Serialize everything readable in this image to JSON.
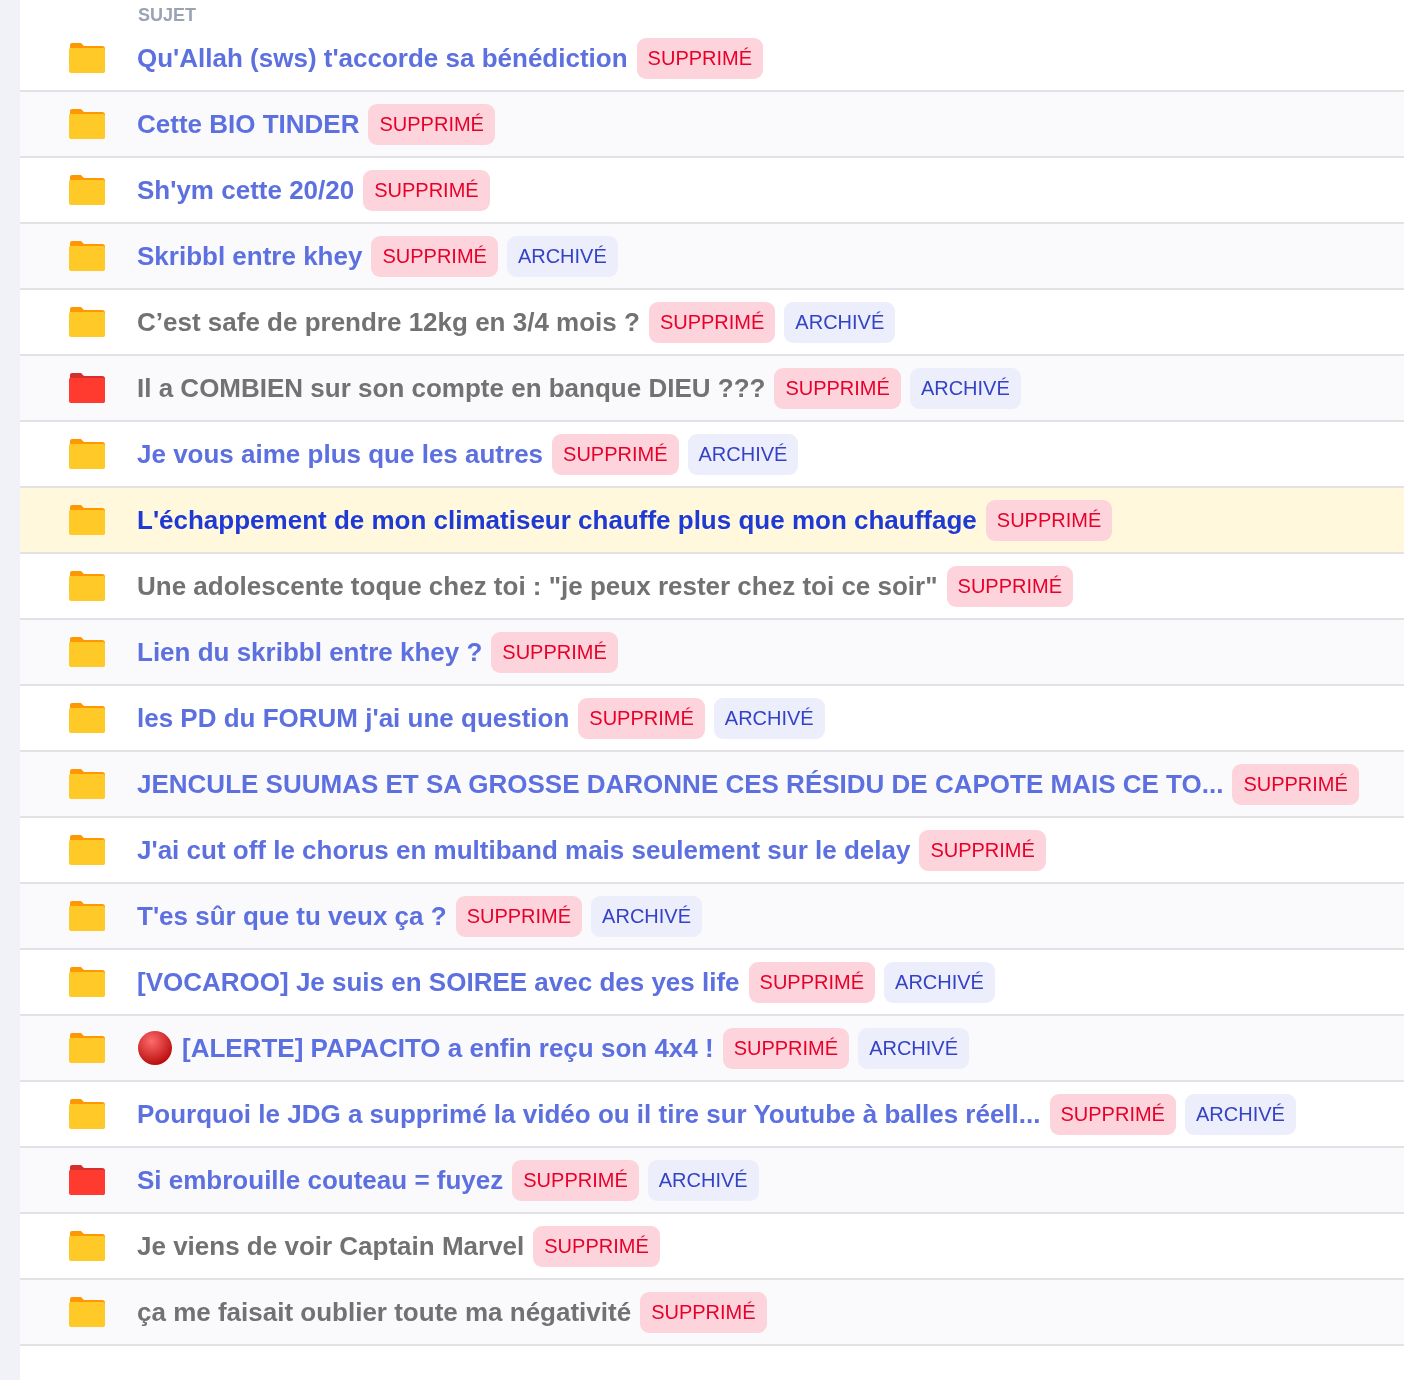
{
  "header": "SUJET",
  "rows": [
    {
      "title": "Qu'Allah (sws) t'accorde sa bénédiction",
      "hot": false,
      "visited": false,
      "highlighted": false,
      "alert": false,
      "tags": [
        {
          "kind": "deleted",
          "label": "SUPPRIMÉ"
        }
      ]
    },
    {
      "title": "Cette BIO TINDER",
      "hot": false,
      "visited": false,
      "highlighted": false,
      "alert": false,
      "tags": [
        {
          "kind": "deleted",
          "label": "SUPPRIMÉ"
        }
      ]
    },
    {
      "title": "Sh'ym cette 20/20",
      "hot": false,
      "visited": false,
      "highlighted": false,
      "alert": false,
      "tags": [
        {
          "kind": "deleted",
          "label": "SUPPRIMÉ"
        }
      ]
    },
    {
      "title": "Skribbl entre khey",
      "hot": false,
      "visited": false,
      "highlighted": false,
      "alert": false,
      "tags": [
        {
          "kind": "deleted",
          "label": "SUPPRIMÉ"
        },
        {
          "kind": "archived",
          "label": "ARCHIVÉ"
        }
      ]
    },
    {
      "title": "C’est safe de prendre 12kg en 3/4 mois ?",
      "hot": false,
      "visited": true,
      "highlighted": false,
      "alert": false,
      "tags": [
        {
          "kind": "deleted",
          "label": "SUPPRIMÉ"
        },
        {
          "kind": "archived",
          "label": "ARCHIVÉ"
        }
      ]
    },
    {
      "title": "Il a COMBIEN sur son compte en banque DIEU ???",
      "hot": true,
      "visited": true,
      "highlighted": false,
      "alert": false,
      "tags": [
        {
          "kind": "deleted",
          "label": "SUPPRIMÉ"
        },
        {
          "kind": "archived",
          "label": "ARCHIVÉ"
        }
      ]
    },
    {
      "title": "Je vous aime plus que les autres",
      "hot": false,
      "visited": false,
      "highlighted": false,
      "alert": false,
      "tags": [
        {
          "kind": "deleted",
          "label": "SUPPRIMÉ"
        },
        {
          "kind": "archived",
          "label": "ARCHIVÉ"
        }
      ]
    },
    {
      "title": "L'échappement de mon climatiseur chauffe plus que mon chauffage",
      "hot": false,
      "visited": false,
      "highlighted": true,
      "alert": false,
      "tags": [
        {
          "kind": "deleted",
          "label": "SUPPRIMÉ"
        }
      ]
    },
    {
      "title": "Une adolescente toque chez toi : \"je peux rester chez toi ce soir\"",
      "hot": false,
      "visited": true,
      "highlighted": false,
      "alert": false,
      "tags": [
        {
          "kind": "deleted",
          "label": "SUPPRIMÉ"
        }
      ]
    },
    {
      "title": "Lien du skribbl entre khey ?",
      "hot": false,
      "visited": false,
      "highlighted": false,
      "alert": false,
      "tags": [
        {
          "kind": "deleted",
          "label": "SUPPRIMÉ"
        }
      ]
    },
    {
      "title": "les PD du FORUM j'ai une question",
      "hot": false,
      "visited": false,
      "highlighted": false,
      "alert": false,
      "tags": [
        {
          "kind": "deleted",
          "label": "SUPPRIMÉ"
        },
        {
          "kind": "archived",
          "label": "ARCHIVÉ"
        }
      ]
    },
    {
      "title": "JENCULE SUUMAS ET SA GROSSE DARONNE CES RÉSIDU DE CAPOTE MAIS CE TO...",
      "hot": false,
      "visited": false,
      "highlighted": false,
      "alert": false,
      "tags": [
        {
          "kind": "deleted",
          "label": "SUPPRIMÉ"
        }
      ]
    },
    {
      "title": "J'ai cut off le chorus en multiband mais seulement sur le delay",
      "hot": false,
      "visited": false,
      "highlighted": false,
      "alert": false,
      "tags": [
        {
          "kind": "deleted",
          "label": "SUPPRIMÉ"
        }
      ]
    },
    {
      "title": "T'es sûr que tu veux ça ?",
      "hot": false,
      "visited": false,
      "highlighted": false,
      "alert": false,
      "tags": [
        {
          "kind": "deleted",
          "label": "SUPPRIMÉ"
        },
        {
          "kind": "archived",
          "label": "ARCHIVÉ"
        }
      ]
    },
    {
      "title": "[VOCAROO] Je suis en SOIREE avec des yes life",
      "hot": false,
      "visited": false,
      "highlighted": false,
      "alert": false,
      "tags": [
        {
          "kind": "deleted",
          "label": "SUPPRIMÉ"
        },
        {
          "kind": "archived",
          "label": "ARCHIVÉ"
        }
      ]
    },
    {
      "title": "[ALERTE] PAPACITO a enfin reçu son 4x4 !",
      "hot": false,
      "visited": false,
      "highlighted": false,
      "alert": true,
      "tags": [
        {
          "kind": "deleted",
          "label": "SUPPRIMÉ"
        },
        {
          "kind": "archived",
          "label": "ARCHIVÉ"
        }
      ]
    },
    {
      "title": "Pourquoi le JDG a supprimé la vidéo ou il tire sur Youtube à balles réell...",
      "hot": false,
      "visited": false,
      "highlighted": false,
      "alert": false,
      "tags": [
        {
          "kind": "deleted",
          "label": "SUPPRIMÉ"
        },
        {
          "kind": "archived",
          "label": "ARCHIVÉ"
        }
      ]
    },
    {
      "title": "Si embrouille couteau = fuyez",
      "hot": true,
      "visited": false,
      "highlighted": false,
      "alert": false,
      "tags": [
        {
          "kind": "deleted",
          "label": "SUPPRIMÉ"
        },
        {
          "kind": "archived",
          "label": "ARCHIVÉ"
        }
      ]
    },
    {
      "title": "Je viens de voir Captain Marvel",
      "hot": false,
      "visited": true,
      "highlighted": false,
      "alert": false,
      "tags": [
        {
          "kind": "deleted",
          "label": "SUPPRIMÉ"
        }
      ]
    },
    {
      "title": "ça me faisait oublier toute ma négativité",
      "hot": false,
      "visited": true,
      "highlighted": false,
      "alert": false,
      "tags": [
        {
          "kind": "deleted",
          "label": "SUPPRIMÉ"
        }
      ]
    }
  ]
}
